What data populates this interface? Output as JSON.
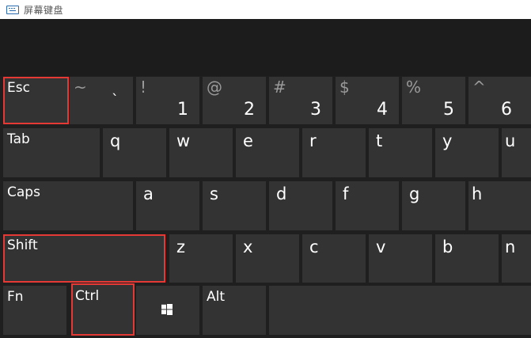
{
  "window": {
    "title": "屏幕键盘"
  },
  "rows": {
    "number": [
      {
        "id": "esc",
        "label": "Esc"
      },
      {
        "id": "tilde",
        "shift": "~",
        "main": "`"
      },
      {
        "id": "1",
        "shift": "!",
        "main": "1"
      },
      {
        "id": "2",
        "shift": "@",
        "main": "2"
      },
      {
        "id": "3",
        "shift": "#",
        "main": "3"
      },
      {
        "id": "4",
        "shift": "$",
        "main": "4"
      },
      {
        "id": "5",
        "shift": "%",
        "main": "5"
      },
      {
        "id": "6",
        "shift": "^",
        "main": "6"
      }
    ],
    "top": [
      {
        "id": "tab",
        "label": "Tab"
      },
      {
        "id": "q",
        "main": "q"
      },
      {
        "id": "w",
        "main": "w"
      },
      {
        "id": "e",
        "main": "e"
      },
      {
        "id": "r",
        "main": "r"
      },
      {
        "id": "t",
        "main": "t"
      },
      {
        "id": "y",
        "main": "y"
      },
      {
        "id": "u",
        "main": "u"
      }
    ],
    "home": [
      {
        "id": "caps",
        "label": "Caps"
      },
      {
        "id": "a",
        "main": "a"
      },
      {
        "id": "s",
        "main": "s"
      },
      {
        "id": "d",
        "main": "d"
      },
      {
        "id": "f",
        "main": "f"
      },
      {
        "id": "g",
        "main": "g"
      },
      {
        "id": "h",
        "main": "h"
      }
    ],
    "bottom": [
      {
        "id": "shift",
        "label": "Shift"
      },
      {
        "id": "z",
        "main": "z"
      },
      {
        "id": "x",
        "main": "x"
      },
      {
        "id": "c",
        "main": "c"
      },
      {
        "id": "v",
        "main": "v"
      },
      {
        "id": "b",
        "main": "b"
      },
      {
        "id": "n",
        "main": "n"
      }
    ],
    "space": [
      {
        "id": "fn",
        "label": "Fn"
      },
      {
        "id": "ctrl",
        "label": "Ctrl"
      },
      {
        "id": "win",
        "icon": "windows-logo-icon"
      },
      {
        "id": "alt",
        "label": "Alt"
      },
      {
        "id": "spacebar"
      }
    ]
  },
  "highlighted_keys": [
    "Esc",
    "Shift",
    "Ctrl"
  ],
  "colors": {
    "key": "#333333",
    "background": "#1f1f1f",
    "highlight": "#e53935",
    "secondary_symbol": "#9a9a9a"
  }
}
